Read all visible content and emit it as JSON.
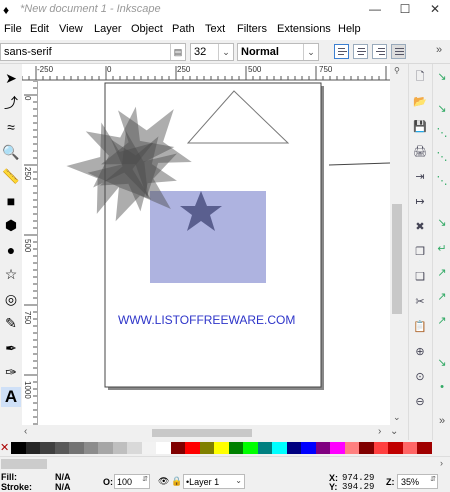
{
  "window": {
    "title": "*New document 1 - Inkscape",
    "minimize": "—",
    "maximize": "☐",
    "close": "✕"
  },
  "menu": [
    "File",
    "Edit",
    "View",
    "Layer",
    "Object",
    "Path",
    "Text",
    "Filters",
    "Extensions",
    "Help"
  ],
  "text_toolbar": {
    "font_family": "sans-serif",
    "font_size": "32",
    "font_style": "Normal",
    "overflow": "»"
  },
  "ruler_labels": {
    "h": [
      "-250",
      "0",
      "250",
      "500",
      "750"
    ],
    "v": [
      "0",
      "250",
      "500",
      "750",
      "1000"
    ]
  },
  "canvas_text": "WWW.LISTOFFREEWARE.COM",
  "colors": {
    "accent_text": "#2e35c9",
    "square_fill": "#aeb3e0",
    "star_fill": "#4a4a4a",
    "star_small": "#5a5f8f"
  },
  "tools": [
    {
      "name": "selector-icon",
      "glyph": "➤"
    },
    {
      "name": "node-tool-icon",
      "glyph": "⤴"
    },
    {
      "name": "tweak-tool-icon",
      "glyph": "≈"
    },
    {
      "name": "zoom-tool-icon",
      "glyph": "🔍"
    },
    {
      "name": "measure-tool-icon",
      "glyph": "📏"
    },
    {
      "name": "rectangle-tool-icon",
      "glyph": "■"
    },
    {
      "name": "3d-box-tool-icon",
      "glyph": "⬢"
    },
    {
      "name": "ellipse-tool-icon",
      "glyph": "●"
    },
    {
      "name": "star-tool-icon",
      "glyph": "☆"
    },
    {
      "name": "spiral-tool-icon",
      "glyph": "◎"
    },
    {
      "name": "pencil-tool-icon",
      "glyph": "✎"
    },
    {
      "name": "pen-tool-icon",
      "glyph": "✒"
    },
    {
      "name": "calligraphy-tool-icon",
      "glyph": "✑"
    },
    {
      "name": "text-tool-icon",
      "glyph": "A"
    }
  ],
  "commands": [
    {
      "name": "new-document-icon",
      "glyph": "🗋"
    },
    {
      "name": "open-icon",
      "glyph": "📂"
    },
    {
      "name": "save-icon",
      "glyph": "💾"
    },
    {
      "name": "print-icon",
      "glyph": "🖨"
    },
    {
      "name": "import-icon",
      "glyph": "⇥"
    },
    {
      "name": "export-icon",
      "glyph": "↦"
    },
    {
      "name": "delete-icon",
      "glyph": "✖"
    },
    {
      "name": "duplicate-icon",
      "glyph": "❐"
    },
    {
      "name": "clone-icon",
      "glyph": "❑"
    },
    {
      "name": "cut-icon",
      "glyph": "✂"
    },
    {
      "name": "paste-icon",
      "glyph": "📋"
    },
    {
      "name": "zoom-fit-icon",
      "glyph": "⊕"
    },
    {
      "name": "zoom-drawing-icon",
      "glyph": "⊙"
    },
    {
      "name": "zoom-page-icon",
      "glyph": "⊖"
    }
  ],
  "status": {
    "fill_label": "Fill:",
    "fill_value": "N/A",
    "stroke_label": "Stroke:",
    "stroke_value": "N/A",
    "opacity_label": "O:",
    "opacity_value": "100",
    "layer": "•Layer 1",
    "x_label": "X:",
    "x_value": "974.29",
    "y_label": "Y:",
    "y_value": "394.29",
    "zoom_label": "Z:",
    "zoom_value": "35%"
  },
  "palette": [
    "#000000",
    "#262626",
    "#404040",
    "#595959",
    "#737373",
    "#8c8c8c",
    "#a6a6a6",
    "#bfbfbf",
    "#d9d9d9",
    "#f2f2f2",
    "#ffffff",
    "#800000",
    "#ff0000",
    "#808000",
    "#ffff00",
    "#008000",
    "#00ff00",
    "#008080",
    "#00ffff",
    "#000080",
    "#0000ff",
    "#800080",
    "#ff00ff",
    "#ff8080",
    "#800000",
    "#ff4040",
    "#c00000",
    "#ff6666",
    "#a00000"
  ]
}
